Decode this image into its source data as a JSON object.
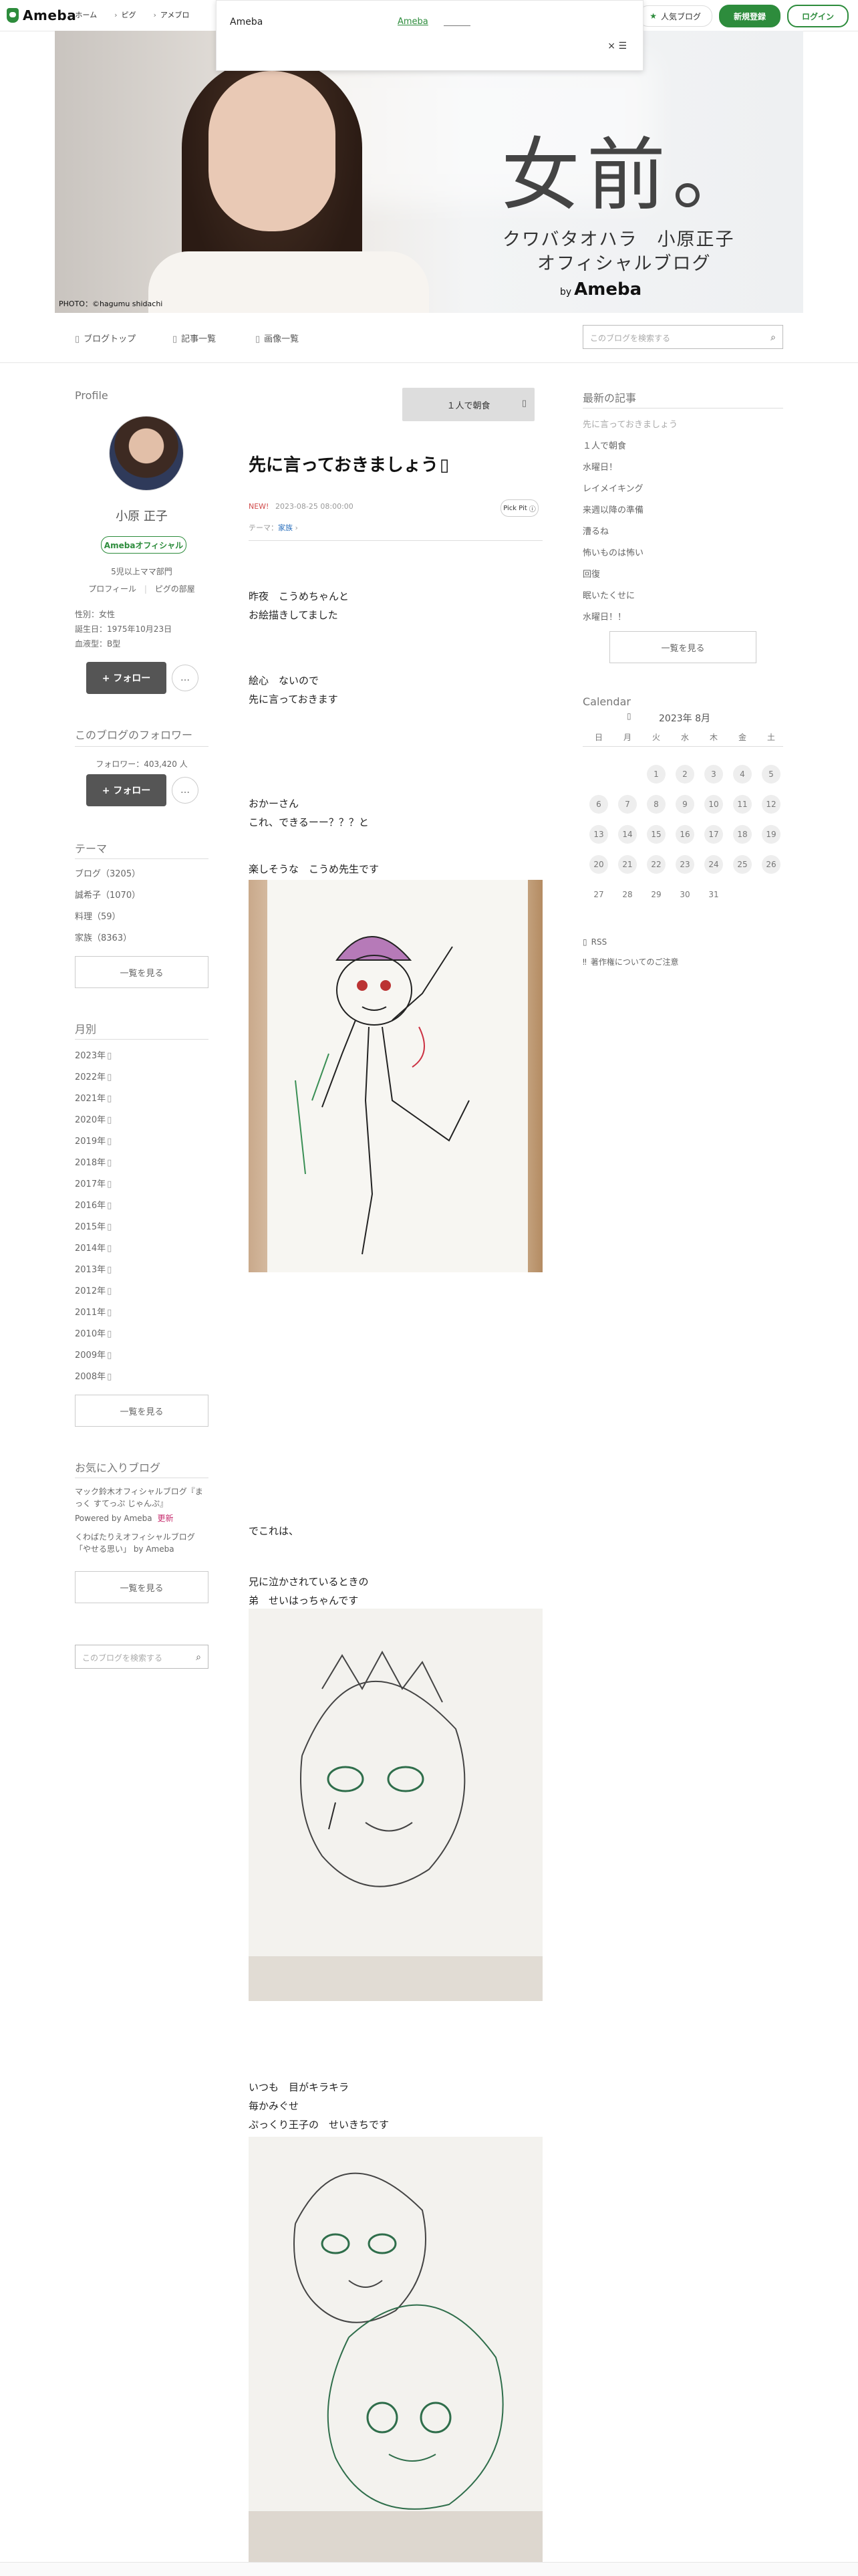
{
  "header": {
    "brand": "Ameba",
    "nav": [
      "ホーム",
      "ピグ",
      "アメブロ"
    ],
    "popular_label": "人気ブログ",
    "signup_label": "新規登録",
    "login_label": "ログイン"
  },
  "popup": {
    "title": "Ameba",
    "link": "Ameba",
    "close": "× ☰"
  },
  "hero": {
    "title": "女前。",
    "subtitle_line1": "クワバタオハラ　小原正子",
    "subtitle_line2": "オフィシャルブログ",
    "by_prefix": "by",
    "by_brand": "Ameba",
    "photo_credit": "PHOTO：©hagumu shidachi"
  },
  "subnav": {
    "blog_top": "ブログトップ",
    "articles": "記事一覧",
    "images": "画像一覧",
    "search_placeholder": "このブログを検索する"
  },
  "profile": {
    "section_title": "Profile",
    "name": "小原 正子",
    "badge": "Amebaオフィシャル",
    "tag": "5児以上ママ部門",
    "links": [
      "プロフィール",
      "ピグの部屋"
    ],
    "gender": "性別：女性",
    "birthday": "誕生日：1975年10月23日",
    "blood": "血液型：B型",
    "follow_label": "+ フォロー",
    "more_label": "…"
  },
  "followers": {
    "section_title": "このブログのフォロワー",
    "count_label": "フォロワー：403,420 人",
    "follow_label": "+ フォロー",
    "more_label": "…"
  },
  "themes": {
    "section_title": "テーマ",
    "items": [
      "ブログ（3205）",
      "誠希子（1070）",
      "料理（59）",
      "家族（8363）"
    ],
    "see_all": "一覧を見る"
  },
  "archive": {
    "section_title": "月別",
    "items": [
      "2023年",
      "2022年",
      "2021年",
      "2020年",
      "2019年",
      "2018年",
      "2017年",
      "2016年",
      "2015年",
      "2014年",
      "2013年",
      "2012年",
      "2011年",
      "2010年",
      "2009年",
      "2008年"
    ],
    "see_all": "一覧を見る"
  },
  "favorites": {
    "section_title": "お気に入りブログ",
    "items": [
      "マック鈴木オフィシャルブログ『まっく すてっぷ じゃんぷ』",
      "Powered by Ameba",
      "くわばたりえオフィシャルブログ「やせる思い」 by Ameba"
    ],
    "update_tag": "更新",
    "see_all": "一覧を見る",
    "search_placeholder": "このブログを検索する"
  },
  "article": {
    "like_label": "１人で朝食",
    "title": "先に言っておきましょう",
    "new_label": "NEW!",
    "datetime": "2023-08-25 08:00:00",
    "theme_prefix": "テーマ：",
    "theme": "家族",
    "pick_label": "Pick Pit",
    "blocks": [
      "昨夜　こうめちゃんと\nお絵描きしてました",
      "絵心　ないので\n先に言っておきます",
      "おかーさん\nこれ、できるーー？？？と",
      "楽しそうな　こうめ先生です",
      "でこれは、",
      "兄に泣かされているときの\n弟　せいはっちゃんです",
      "いつも　目がキラキラ\n毎かみぐせ\nぷっくり王子の　せいきちです"
    ]
  },
  "recent": {
    "section_title": "最新の記事",
    "items": [
      "先に言っておきましょう",
      "１人で朝食",
      "水曜日！",
      "レイメイキング",
      "来週以降の準備",
      "漕るね",
      "怖いものは怖い",
      "回復",
      "眠いたくせに",
      "水曜日！！"
    ],
    "see_all": "一覧を見る"
  },
  "calendar": {
    "section_title": "Calendar",
    "month_label": "2023年 8月",
    "dow": [
      "日",
      "月",
      "火",
      "水",
      "木",
      "金",
      "土"
    ],
    "weeks": [
      [
        "",
        "",
        "1",
        "2",
        "3",
        "4",
        "5"
      ],
      [
        "6",
        "7",
        "8",
        "9",
        "10",
        "11",
        "12"
      ],
      [
        "13",
        "14",
        "15",
        "16",
        "17",
        "18",
        "19"
      ],
      [
        "20",
        "21",
        "22",
        "23",
        "24",
        "25",
        "26"
      ],
      [
        "27",
        "28",
        "29",
        "30",
        "31",
        "",
        ""
      ]
    ],
    "rss": "RSS",
    "copyright_note": "著作権についてのご注意"
  }
}
